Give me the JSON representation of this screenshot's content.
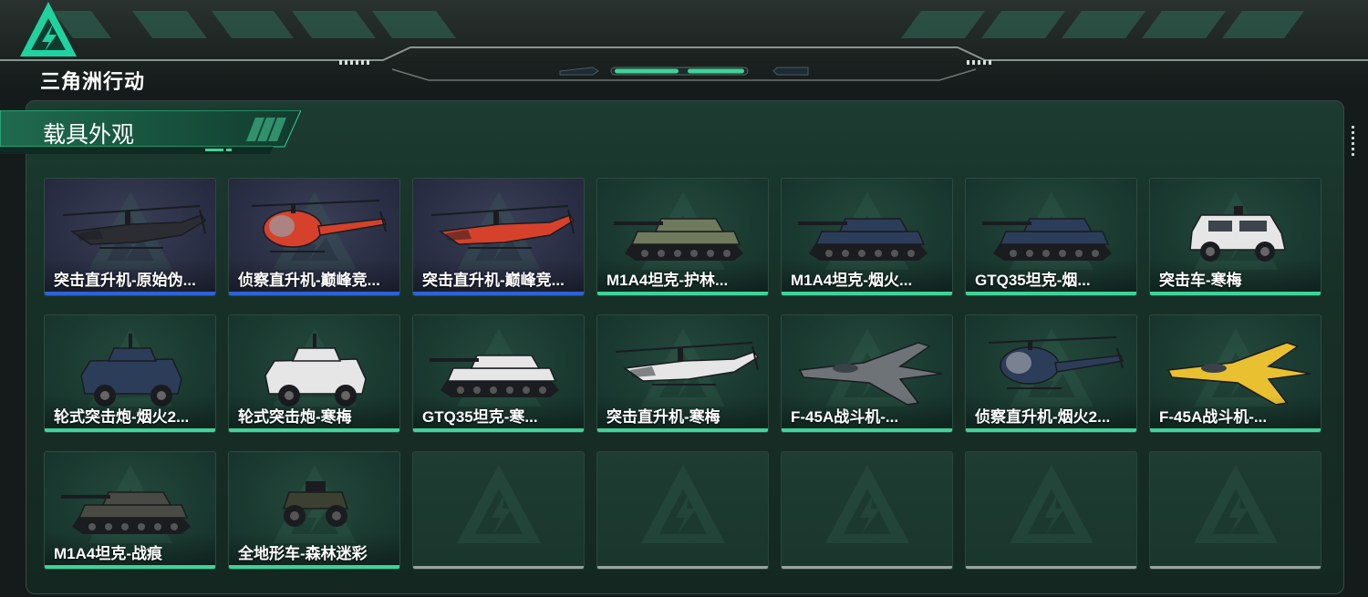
{
  "app": {
    "logo_text": "三角洲行动"
  },
  "panel": {
    "title": "载具外观"
  },
  "colors": {
    "accent_green": "#3ed39a",
    "accent_blue": "#2c63d9",
    "empty_gray": "#9aa3a0"
  },
  "items": [
    {
      "label": "突击直升机-原始伪...",
      "rarity": "blue",
      "kind": "attack-helicopter",
      "tint": "#2b2d33"
    },
    {
      "label": "侦察直升机-巅峰竞...",
      "rarity": "blue",
      "kind": "scout-helicopter",
      "tint": "#d6412b"
    },
    {
      "label": "突击直升机-巅峰竞...",
      "rarity": "blue",
      "kind": "attack-helicopter",
      "tint": "#d6412b"
    },
    {
      "label": "M1A4坦克-护林...",
      "rarity": "green",
      "kind": "tank",
      "tint": "#6f7a5c"
    },
    {
      "label": "M1A4坦克-烟火...",
      "rarity": "green",
      "kind": "tank",
      "tint": "#2c3d5a"
    },
    {
      "label": "GTQ35坦克-烟...",
      "rarity": "green",
      "kind": "tank",
      "tint": "#2c3d5a"
    },
    {
      "label": "突击车-寒梅",
      "rarity": "green",
      "kind": "assault-vehicle",
      "tint": "#e6e6e6"
    },
    {
      "label": "轮式突击炮-烟火2...",
      "rarity": "green",
      "kind": "wheeled-gun",
      "tint": "#2c3d5a"
    },
    {
      "label": "轮式突击炮-寒梅",
      "rarity": "green",
      "kind": "wheeled-gun",
      "tint": "#e6e6e6"
    },
    {
      "label": "GTQ35坦克-寒...",
      "rarity": "green",
      "kind": "tank",
      "tint": "#e6e6e6"
    },
    {
      "label": "突击直升机-寒梅",
      "rarity": "green",
      "kind": "attack-helicopter",
      "tint": "#e6e6e6"
    },
    {
      "label": "F-45A战斗机-...",
      "rarity": "green",
      "kind": "fighter-jet",
      "tint": "#6e7378"
    },
    {
      "label": "侦察直升机-烟火2...",
      "rarity": "green",
      "kind": "scout-helicopter",
      "tint": "#2c3d5a"
    },
    {
      "label": "F-45A战斗机-...",
      "rarity": "green",
      "kind": "fighter-jet",
      "tint": "#e9c030"
    },
    {
      "label": "M1A4坦克-战痕",
      "rarity": "green",
      "kind": "tank",
      "tint": "#4a4a44"
    },
    {
      "label": "全地形车-森林迷彩",
      "rarity": "green",
      "kind": "atv",
      "tint": "#3b4030"
    },
    {
      "label": "",
      "rarity": "empty",
      "kind": "empty",
      "tint": ""
    },
    {
      "label": "",
      "rarity": "empty",
      "kind": "empty",
      "tint": ""
    },
    {
      "label": "",
      "rarity": "empty",
      "kind": "empty",
      "tint": ""
    },
    {
      "label": "",
      "rarity": "empty",
      "kind": "empty",
      "tint": ""
    },
    {
      "label": "",
      "rarity": "empty",
      "kind": "empty",
      "tint": ""
    }
  ]
}
